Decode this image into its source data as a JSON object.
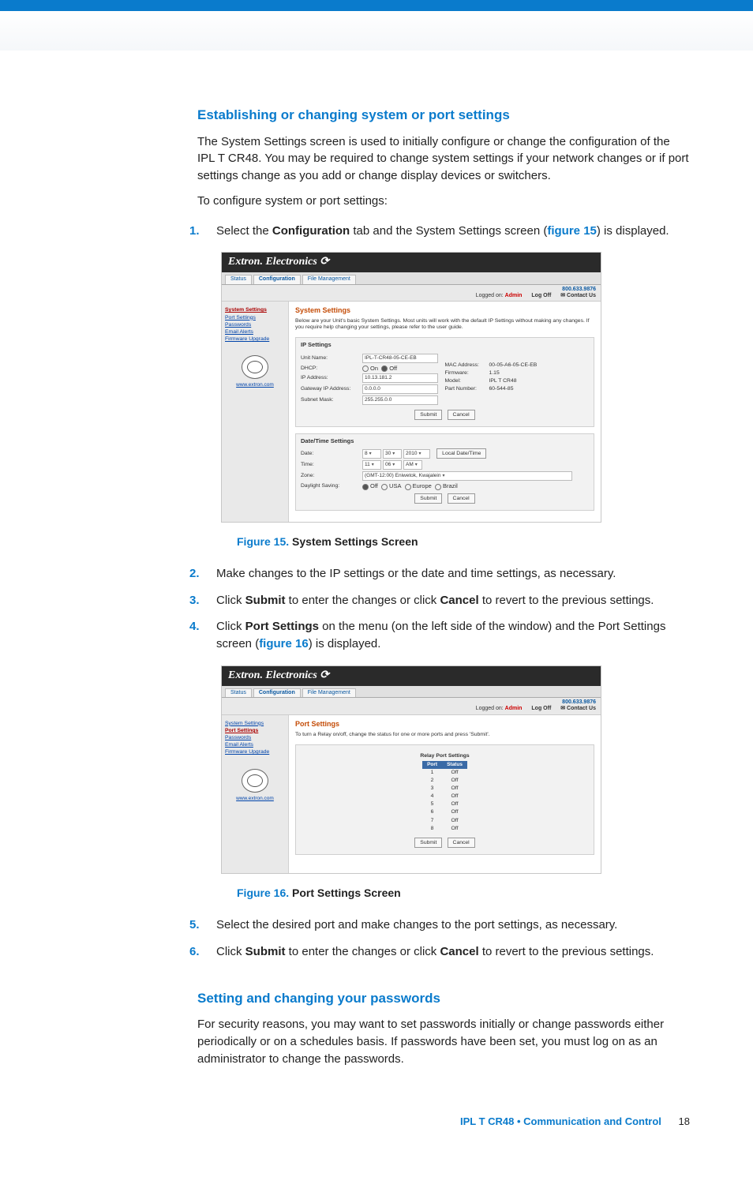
{
  "section1_title": "Establishing or changing system or port settings",
  "intro1": "The System Settings screen is used to initially configure or change the configuration of the IPL T CR48. You may be required to change system settings if your network changes or if port settings change as you add or change display devices or switchers.",
  "intro2": "To configure system or port settings:",
  "steps_a": {
    "s1_pre": "Select the ",
    "s1_kw": "Configuration",
    "s1_mid": " tab and the System Settings screen (",
    "s1_figref": "figure 15",
    "s1_post": ") is displayed."
  },
  "fig15": {
    "no": "Figure 15.",
    "txt": "System Settings Screen"
  },
  "steps_b": {
    "s2": "Make changes to the IP settings or the date and time settings, as necessary.",
    "s3_pre": "Click ",
    "s3_kw1": "Submit",
    "s3_mid": " to enter the changes or click ",
    "s3_kw2": "Cancel",
    "s3_post": " to revert to the previous settings.",
    "s4_pre": "Click ",
    "s4_kw": "Port Settings",
    "s4_mid": " on the menu (on the left side of the window) and the Port Settings screen (",
    "s4_figref": "figure 16",
    "s4_post": ") is displayed."
  },
  "fig16": {
    "no": "Figure 16.",
    "txt": "Port Settings Screen"
  },
  "steps_c": {
    "s5": "Select the desired port and make changes to the port settings, as necessary.",
    "s6_pre": "Click ",
    "s6_kw1": "Submit",
    "s6_mid": " to enter the changes or click ",
    "s6_kw2": "Cancel",
    "s6_post": " to revert to the previous settings."
  },
  "section2_title": "Setting and changing your passwords",
  "pw_para": "For security reasons, you may want to set passwords initially or change passwords either periodically or on a schedules basis. If passwords have been set, you must log on as an administrator to change the passwords.",
  "footer": {
    "doc": "IPL T CR48 • Communication and Control",
    "page": "18"
  },
  "screenshot_common": {
    "brand": "Extron. Electronics ⟳",
    "tabs": {
      "status": "Status",
      "config": "Configuration",
      "file": "File Management"
    },
    "phone": "800.633.9876",
    "logged_pre": "Logged on: ",
    "logged_user": "Admin",
    "logoff": "Log Off",
    "contact": "✉ Contact Us",
    "sidebar": {
      "sys": "System Settings",
      "port": "Port Settings",
      "pw": "Passwords",
      "email": "Email Alerts",
      "fw": "Firmware Upgrade",
      "site": "www.extron.com"
    },
    "buttons": {
      "submit": "Submit",
      "cancel": "Cancel"
    }
  },
  "shot1": {
    "title": "System Settings",
    "desc": "Below are your Unit's basic System Settings. Most units will work with the default IP Settings without making any changes. If you require help changing your settings, please refer to the user guide.",
    "ip": {
      "heading": "IP Settings",
      "unit_label": "Unit Name:",
      "unit_value": "IPL-T-CR48-05-CE-EB",
      "dhcp_label": "DHCP:",
      "dhcp_on": "On",
      "dhcp_off": "Off",
      "ip_label": "IP Address:",
      "ip_value": "10.13.181.2",
      "gw_label": "Gateway IP Address:",
      "gw_value": "0.0.0.0",
      "sub_label": "Subnet Mask:",
      "sub_value": "255.255.0.0",
      "mac_label": "MAC Address:",
      "mac_value": "00-05-A6-05-CE-EB",
      "fw_label": "Firmware:",
      "fw_value": "1.15",
      "model_label": "Model:",
      "model_value": "IPL T CR48",
      "part_label": "Part Number:",
      "part_value": "60-544-85"
    },
    "dt": {
      "heading": "Date/Time Settings",
      "date_label": "Date:",
      "date_m": "8",
      "date_d": "30",
      "date_y": "2010",
      "local_btn": "Local Date/Time",
      "time_label": "Time:",
      "time_h": "11",
      "time_m": "06",
      "time_ap": "AM",
      "zone_label": "Zone:",
      "zone_value": "(GMT-12:00) Eniwetok, Kwajalein",
      "ds_label": "Daylight Saving:",
      "ds_off": "Off",
      "ds_usa": "USA",
      "ds_eu": "Europe",
      "ds_br": "Brazil"
    }
  },
  "shot2": {
    "title": "Port Settings",
    "desc": "To turn a Relay on/off, change the status for one or more ports and press 'Submit'.",
    "table_title": "Relay Port Settings",
    "col_port": "Port",
    "col_status": "Status",
    "ports": [
      "1",
      "2",
      "3",
      "4",
      "5",
      "6",
      "7",
      "8"
    ],
    "status_value": "Off"
  }
}
